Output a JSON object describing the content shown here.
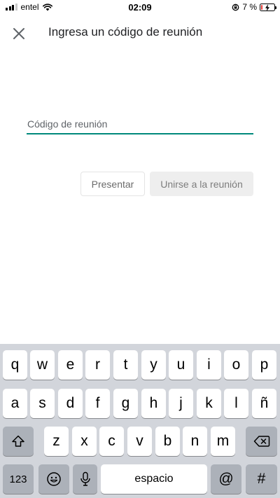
{
  "status_bar": {
    "carrier": "entel",
    "time": "02:09",
    "battery_text": "7 %",
    "battery_level": 0.07
  },
  "header": {
    "close_icon": "close-icon",
    "title": "Ingresa un código de reunión"
  },
  "form": {
    "code_placeholder": "Código de reunión",
    "code_value": "",
    "accent_color": "#00897b"
  },
  "actions": {
    "present_label": "Presentar",
    "join_label": "Unirse a la reunión"
  },
  "keyboard": {
    "row1": [
      "q",
      "w",
      "e",
      "r",
      "t",
      "y",
      "u",
      "i",
      "o",
      "p"
    ],
    "row2": [
      "a",
      "s",
      "d",
      "f",
      "g",
      "h",
      "j",
      "k",
      "l",
      "ñ"
    ],
    "row3": [
      "z",
      "x",
      "c",
      "v",
      "b",
      "n",
      "m"
    ],
    "numbers_label": "123",
    "space_label": "espacio",
    "at_label": "@",
    "hash_label": "#",
    "shift_icon": "shift-icon",
    "delete_icon": "backspace-icon",
    "emoji_icon": "emoji-icon",
    "mic_icon": "microphone-icon"
  }
}
